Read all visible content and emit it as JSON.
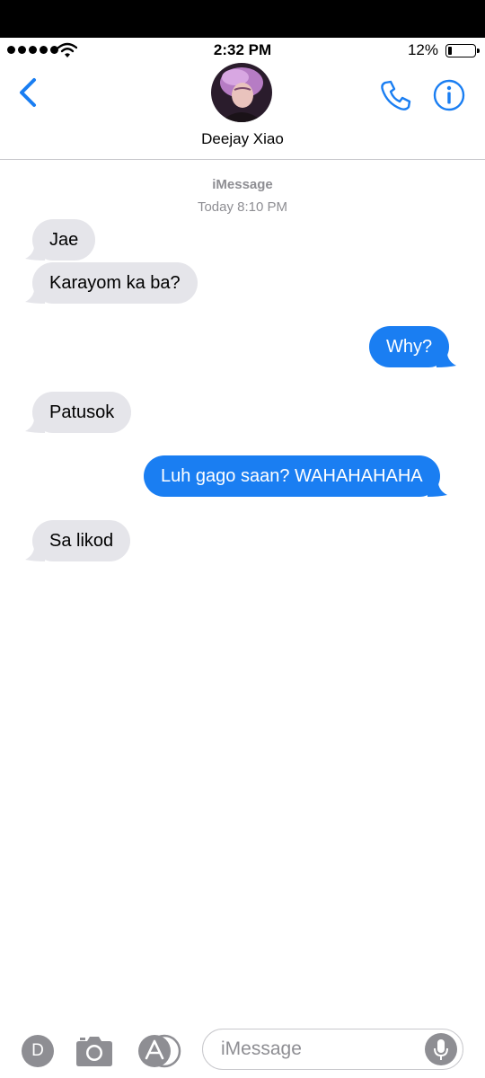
{
  "status_bar": {
    "time": "2:32 PM",
    "battery": "12%",
    "battery_level": 0.12,
    "signal_bars": 5
  },
  "header": {
    "contact_name": "Deejay Xiao",
    "back_icon": "chevron-left-icon",
    "call_icon": "phone-icon",
    "info_icon": "info-icon"
  },
  "thread": {
    "service": "iMessage",
    "timestamp": "Today 8:10 PM",
    "messages": [
      {
        "direction": "incoming",
        "text": "Jae"
      },
      {
        "direction": "incoming",
        "text": "Karayom ka ba?"
      },
      {
        "direction": "outgoing",
        "text": "Why?"
      },
      {
        "direction": "incoming",
        "text": "Patusok"
      },
      {
        "direction": "outgoing",
        "text": "Luh gago saan? WAHAHAHAHA"
      },
      {
        "direction": "incoming",
        "text": "Sa likod"
      }
    ]
  },
  "composer": {
    "app_initial": "D",
    "placeholder": "iMessage",
    "camera_icon": "camera-icon",
    "appstore_icon": "app-store-icon",
    "mic_icon": "microphone-icon"
  },
  "colors": {
    "accent": "#1a7ef2",
    "incoming_bubble": "#e5e5ea",
    "outgoing_bubble": "#1a7ef2",
    "secondary_text": "#8e8e93"
  }
}
